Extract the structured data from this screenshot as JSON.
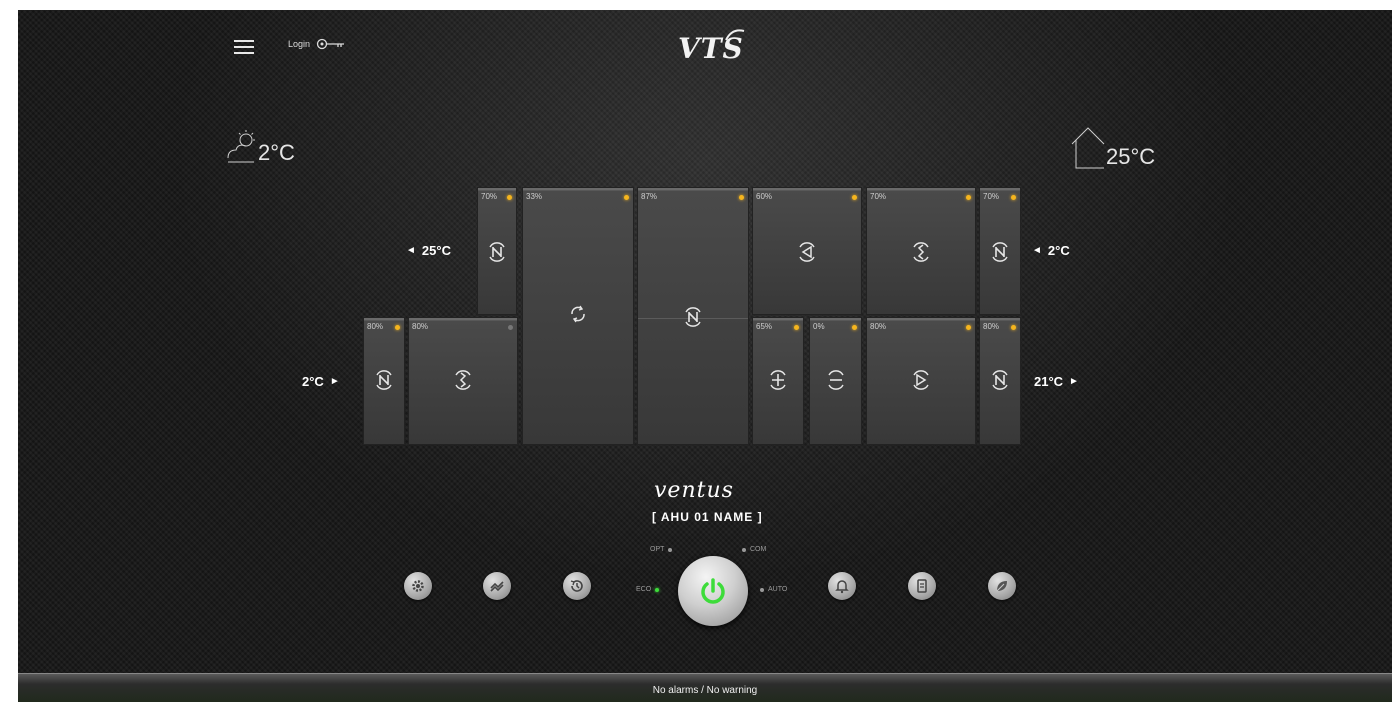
{
  "header": {
    "login_label": "Login",
    "logo_text": "VTS"
  },
  "weather": {
    "outdoor_temp": "2°C",
    "indoor_temp": "25°C"
  },
  "unit": {
    "top_row": [
      {
        "percent": "70%",
        "icon": "damper-icon",
        "led": "on"
      },
      {
        "percent": "33%",
        "icon": "rotary-exchanger-icon",
        "led": "on"
      },
      {
        "percent": "87%",
        "icon": "damper-icon",
        "led": "on"
      },
      {
        "percent": "60%",
        "icon": "fan-left-icon",
        "led": "on"
      },
      {
        "percent": "70%",
        "icon": "filter-icon",
        "led": "on"
      },
      {
        "percent": "70%",
        "icon": "damper-icon",
        "led": "on"
      }
    ],
    "bottom_row": [
      {
        "percent": "80%",
        "icon": "damper-icon",
        "led": "on"
      },
      {
        "percent": "80%",
        "icon": "filter-icon",
        "led": "off"
      },
      {
        "percent": "65%",
        "icon": "heater-icon",
        "led": "on"
      },
      {
        "percent": "0%",
        "icon": "cooler-icon",
        "led": "on"
      },
      {
        "percent": "80%",
        "icon": "fan-right-icon",
        "led": "on"
      },
      {
        "percent": "80%",
        "icon": "damper-icon",
        "led": "on"
      }
    ],
    "temps": {
      "extract_in": "25°C",
      "exhaust_out": "2°C",
      "fresh_in": "2°C",
      "supply_out": "21°C"
    }
  },
  "brand": {
    "product": "ventus",
    "unit_name": "[ AHU  01 NAME ]"
  },
  "controls": {
    "modes": {
      "opt": "OPT",
      "com": "COM",
      "eco": "ECO",
      "auto": "AUTO"
    },
    "buttons": [
      "gear-icon",
      "chart-icon",
      "history-icon",
      "bell-icon",
      "document-icon",
      "leaf-icon"
    ],
    "power_color": "#3ddc3a"
  },
  "status_bar": {
    "text": "No alarms / No warning"
  }
}
